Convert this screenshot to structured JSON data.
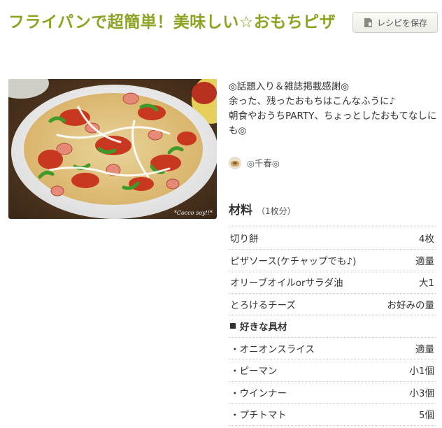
{
  "recipe": {
    "title": "フライパンで超簡単！美味しい☆おもちピザ",
    "save_label": "レシピを保存",
    "description": "◎話題入り＆雑誌掲載感謝◎\n余った、残ったおもちはこんなふうに♪\n朝食やおうちPARTY、ちょっとしたおもてなしにも◎",
    "author": "◎千春◎",
    "photo_watermark": "*Cocco soy!!*"
  },
  "ingredients": {
    "heading": "材料",
    "servings": "（1枚分）",
    "items": [
      {
        "name": "切り餅",
        "qty": "4枚"
      },
      {
        "name": "ピザソース(ケチャップでも♪)",
        "qty": "適量"
      },
      {
        "name": "オリーブオイルorサラダ油",
        "qty": "大1"
      },
      {
        "name": "とろけるチーズ",
        "qty": "お好みの量"
      }
    ],
    "group_label": "好きな具材",
    "group_items": [
      {
        "name": "・オニオンスライス",
        "qty": "適量"
      },
      {
        "name": "・ピーマン",
        "qty": "小1個"
      },
      {
        "name": "・ウインナー",
        "qty": "小3個"
      },
      {
        "name": "・プチトマト",
        "qty": "5個"
      }
    ]
  },
  "icons": {
    "save": "bookmark-icon"
  },
  "colors": {
    "title": "#8ba422",
    "text": "#333333"
  }
}
